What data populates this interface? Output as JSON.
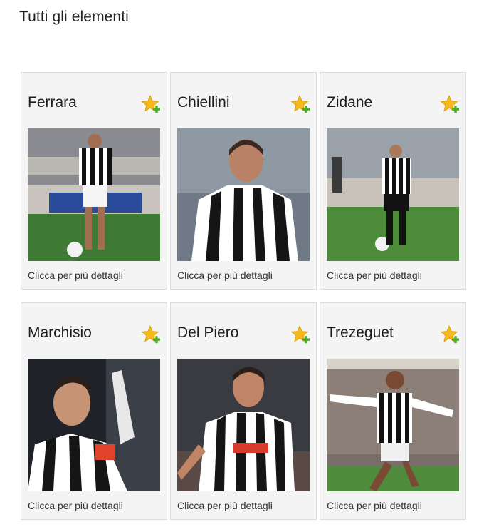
{
  "page": {
    "title": "Tutti gli elementi"
  },
  "cards": [
    {
      "name": "Ferrara",
      "caption": "Clicca per più dettagli",
      "photo_desc": "ferrara-photo",
      "scene": "stadium"
    },
    {
      "name": "Chiellini",
      "caption": "Clicca per più dettagli",
      "photo_desc": "chiellini-photo",
      "scene": "portrait"
    },
    {
      "name": "Zidane",
      "caption": "Clicca per più dettagli",
      "photo_desc": "zidane-photo",
      "scene": "stadium"
    },
    {
      "name": "Marchisio",
      "caption": "Clicca per più dettagli",
      "photo_desc": "marchisio-photo",
      "scene": "celebrate"
    },
    {
      "name": "Del Piero",
      "caption": "Clicca per più dettagli",
      "photo_desc": "del-piero-photo",
      "scene": "celebrate"
    },
    {
      "name": "Trezeguet",
      "caption": "Clicca per più dettagli",
      "photo_desc": "trezeguet-photo",
      "scene": "crowd"
    }
  ],
  "icons": {
    "favorite": "star-plus-icon"
  },
  "colors": {
    "card_bg": "#f4f4f4",
    "card_border": "#dcdcdc",
    "star": "#f5b91a",
    "plus": "#4caf2a"
  }
}
